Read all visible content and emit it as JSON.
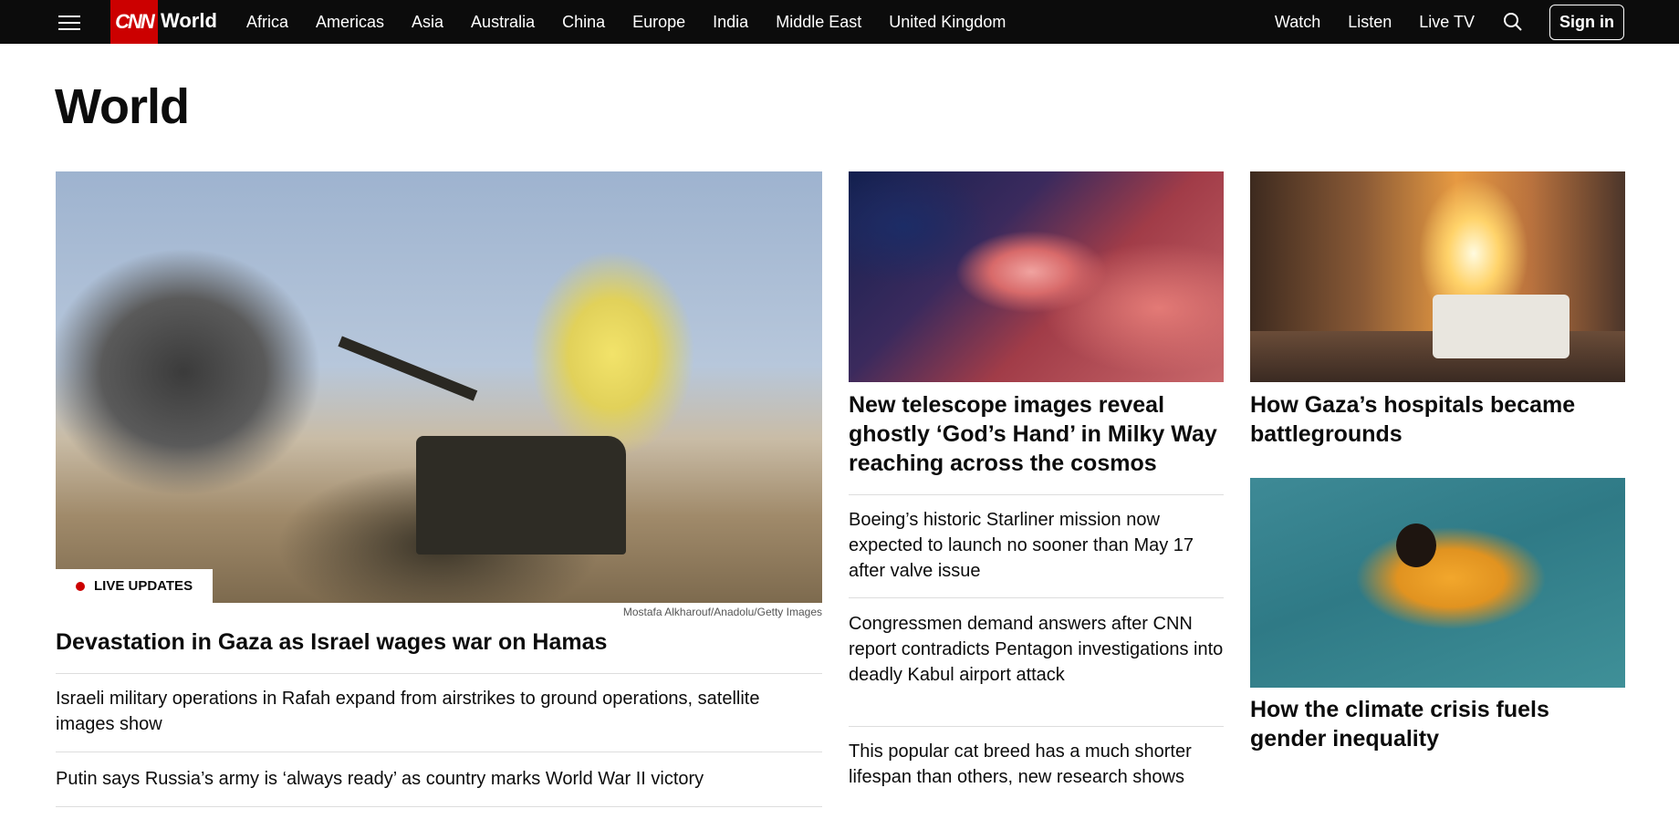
{
  "nav": {
    "logo": "CNN",
    "section": "World",
    "links": [
      "Africa",
      "Americas",
      "Asia",
      "Australia",
      "China",
      "Europe",
      "India",
      "Middle East",
      "United Kingdom"
    ],
    "right_links": [
      "Watch",
      "Listen",
      "Live TV"
    ],
    "sign_in": "Sign in"
  },
  "page": {
    "title": "World"
  },
  "lead": {
    "badge": "LIVE UPDATES",
    "credit": "Mostafa Alkharouf/Anadolu/Getty Images",
    "headline": "Devastation in Gaza as Israel wages war on Hamas",
    "related": [
      "Israeli military operations in Rafah expand from airstrikes to ground operations, satellite images show",
      "Putin says Russia’s army is ‘always ready’ as country marks World War II victory"
    ]
  },
  "middle": {
    "headline": "New telescope images reveal ghostly ‘God’s Hand’ in Milky Way reaching across the cosmos",
    "stories": [
      "Boeing’s historic Starliner mission now expected to launch no sooner than May 17 after valve issue",
      "Congressmen demand answers after CNN report contradicts Pentagon investigations into deadly Kabul airport attack",
      "This popular cat breed has a much shorter lifespan than others, new research shows"
    ]
  },
  "right": {
    "headline_1": "How Gaza’s hospitals became battlegrounds",
    "headline_2": "How the climate crisis fuels gender inequality"
  },
  "colors": {
    "nav_bg": "#0c0c0c",
    "brand_red": "#cc0000"
  }
}
